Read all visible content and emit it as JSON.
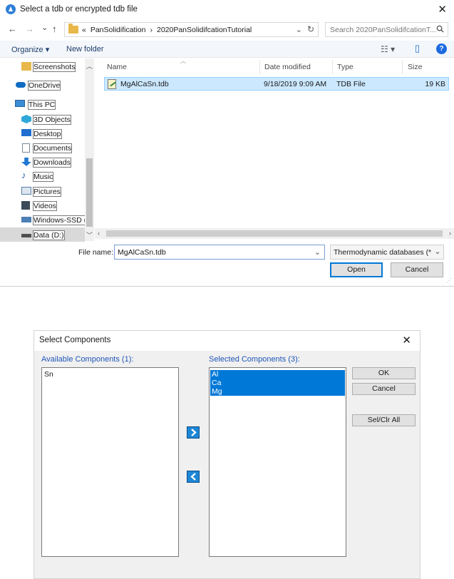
{
  "file_dialog": {
    "title": "Select a tdb or encrypted tdb file",
    "close_glyph": "✕",
    "nav": {
      "back": "←",
      "forward": "→",
      "recent": "⌄",
      "up": "↑"
    },
    "address": {
      "segments": [
        "«",
        "PanSolidification",
        "›",
        "2020PanSolidifcationTutorial"
      ],
      "dropdown": "⌄",
      "refresh": "↻"
    },
    "search_placeholder": "Search 2020PanSolidifcationT...",
    "toolbar": {
      "organize": "Organize ▾",
      "new_folder": "New folder",
      "view": "☷ ▾",
      "pane": "▯",
      "help": "?"
    },
    "sidebar": [
      {
        "label": "Screenshots",
        "icon": "folder-icon",
        "color": "#e8b84a"
      },
      {
        "label": "OneDrive",
        "icon": "cloud-icon",
        "color": "#0f6cc2"
      },
      {
        "label": "This PC",
        "icon": "computer-icon",
        "color": "#3a8ed6"
      },
      {
        "label": "3D Objects",
        "icon": "cube-icon",
        "color": "#2fa8d8"
      },
      {
        "label": "Desktop",
        "icon": "desktop-icon",
        "color": "#1f6fd1"
      },
      {
        "label": "Documents",
        "icon": "document-icon",
        "color": "#7b8a99"
      },
      {
        "label": "Downloads",
        "icon": "download-icon",
        "color": "#1f78d1"
      },
      {
        "label": "Music",
        "icon": "music-icon",
        "color": "#1f5fb0"
      },
      {
        "label": "Pictures",
        "icon": "picture-icon",
        "color": "#5a7fa8"
      },
      {
        "label": "Videos",
        "icon": "video-icon",
        "color": "#3d4a57"
      },
      {
        "label": "Windows-SSD (C",
        "icon": "drive-c-icon",
        "color": "#4c7fb5"
      },
      {
        "label": "Data (D:)",
        "icon": "drive-icon",
        "color": "#505050"
      }
    ],
    "columns": {
      "name": "Name",
      "date": "Date modified",
      "type": "Type",
      "size": "Size"
    },
    "files": [
      {
        "name": "MgAlCaSn.tdb",
        "date": "9/18/2019 9:09 AM",
        "type": "TDB File",
        "size": "19 KB"
      }
    ],
    "filename_label": "File name:",
    "filename_value": "MgAlCaSn.tdb",
    "filetype_value": "Thermodynamic databases (*.tdb)",
    "open_label": "Open",
    "cancel_label": "Cancel"
  },
  "select_components": {
    "title": "Select Components",
    "close_glyph": "✕",
    "available_label": "Available Components (1):",
    "available": [
      "Sn"
    ],
    "selected_label": "Selected Components (3):",
    "selected": [
      "Al",
      "Ca",
      "Mg"
    ],
    "ok_label": "OK",
    "cancel_label": "Cancel",
    "sel_clr_label": "Sel/Clr All"
  },
  "colors": {
    "accent": "#0078d7",
    "selection_row": "#cce8ff",
    "label_blue": "#1f56b8"
  }
}
